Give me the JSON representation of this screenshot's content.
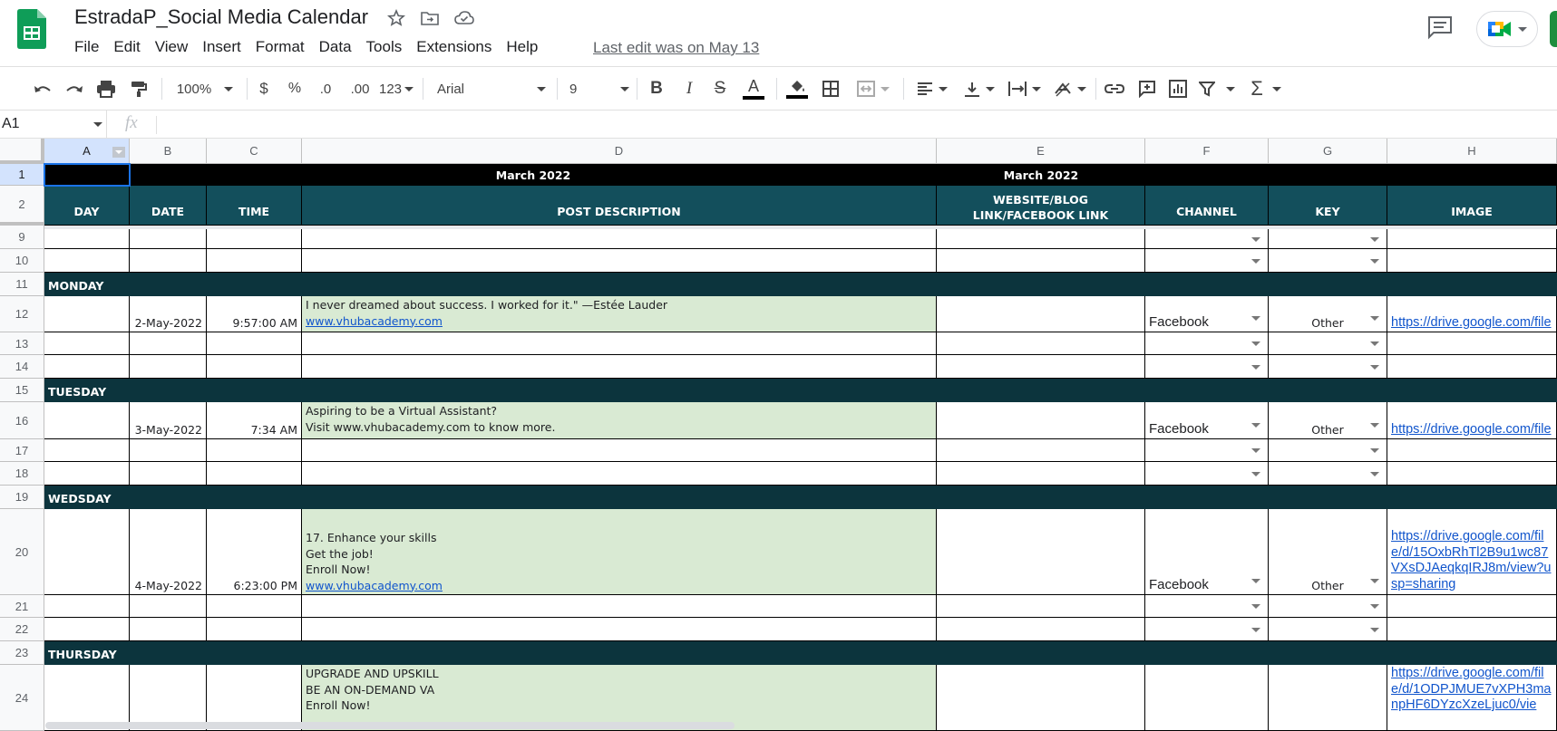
{
  "app": {
    "title": "EstradaP_Social Media Calendar",
    "last_edit": "Last edit was on May 13",
    "menus": [
      "File",
      "Edit",
      "View",
      "Insert",
      "Format",
      "Data",
      "Tools",
      "Extensions",
      "Help"
    ],
    "brand_color": "#0f9d58"
  },
  "toolbar": {
    "zoom": "100%",
    "currency": "$",
    "percent": "%",
    "dec_less": ".0",
    "dec_more": ".00",
    "more_formats": "123",
    "font": "Arial",
    "font_size": "9"
  },
  "formula_bar": {
    "cell_ref": "A1",
    "fx": "fx",
    "value": ""
  },
  "columns": [
    "A",
    "B",
    "C",
    "D",
    "E",
    "F",
    "G",
    "H"
  ],
  "row_numbers": [
    "1",
    "2",
    "9",
    "10",
    "11",
    "12",
    "13",
    "14",
    "15",
    "16",
    "17",
    "18",
    "19",
    "20",
    "21",
    "22",
    "23",
    "24"
  ],
  "sheet": {
    "month_d": "March 2022",
    "month_e": "March 2022",
    "headers": {
      "day": "DAY",
      "date": "DATE",
      "time": "TIME",
      "post": "POST DESCRIPTION",
      "link": "WEBSITE/BLOG LINK/FACEBOOK LINK",
      "channel": "CHANNEL",
      "key": "KEY",
      "image": "IMAGE"
    },
    "days": {
      "monday": "MONDAY",
      "tuesday": "TUESDAY",
      "wedsday": "WEDSDAY",
      "thursday": "THURSDAY"
    },
    "posts": {
      "r12": {
        "date": "2-May-2022",
        "time": "9:57:00 AM",
        "line1": "I never dreamed about success. I worked for it.\" —Estée Lauder",
        "link": "www.vhubacademy.com",
        "channel": "Facebook",
        "key": "Other",
        "image": "https://drive.google.com/file"
      },
      "r16": {
        "date": "3-May-2022",
        "time": "7:34 AM",
        "line1": "Aspiring to be a Virtual Assistant?",
        "line2": "Visit www.vhubacademy.com to know more.",
        "channel": "Facebook",
        "key": "Other",
        "image": "https://drive.google.com/file"
      },
      "r20": {
        "date": "4-May-2022",
        "time": "6:23:00 PM",
        "line1": "17. Enhance your skills",
        "line2": "Get the job!",
        "line3": "Enroll Now!",
        "link": "www.vhubacademy.com",
        "channel": "Facebook",
        "key": "Other",
        "image": "https://drive.google.com/file/d/15OxbRhTl2B9u1wc87VXsDJAeqkqIRJ8m/view?usp=sharing"
      },
      "r24": {
        "line1": "UPGRADE AND UPSKILL",
        "line2": "BE AN ON-DEMAND VA",
        "line3": "Enroll Now!",
        "image": "https://drive.google.com/file/d/1ODPJMUE7vXPH3manpHF6DYzcXzeLjuc0/vie"
      }
    }
  },
  "colors": {
    "header_teal": "#134f5c",
    "day_band": "#0c343d",
    "post_green": "#d9ead3",
    "selection_blue": "#1a73e8"
  }
}
